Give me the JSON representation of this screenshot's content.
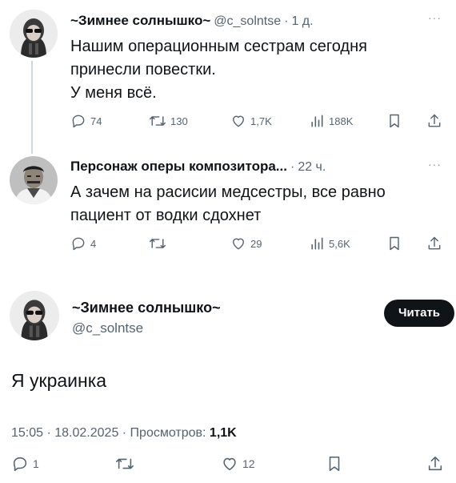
{
  "tweets": [
    {
      "author": "~Зимнее солнышко~",
      "handle": "@c_solntse",
      "time": "1 д.",
      "lines": [
        "Нашим операционным сестрам сегодня",
        "принесли повестки.",
        "У меня всё."
      ],
      "replies": "74",
      "retweets": "130",
      "likes": "1,7K",
      "views": "188K"
    },
    {
      "author": "Персонаж оперы композитора...",
      "time": "22 ч.",
      "lines": [
        "А зачем на расисии медсестры, все равно",
        "пациент от водки сдохнет"
      ],
      "replies": "4",
      "retweets": "",
      "likes": "29",
      "views": "5,6K"
    }
  ],
  "main": {
    "author": "~Зимнее солнышко~",
    "handle": "@c_solntse",
    "follow_label": "Читать",
    "text": "Я украинка",
    "timestamp": "15:05 · 18.02.2025 · Просмотров:",
    "views": "1,1K",
    "replies": "1",
    "retweets": "",
    "likes": "12"
  },
  "separator": "·",
  "more_glyph": "···",
  "colors": {
    "text": "#0f1419",
    "secondary": "#536471",
    "line": "#cfd9de",
    "button": "#0f1419"
  },
  "icons": [
    "reply-icon",
    "retweet-icon",
    "like-icon",
    "views-icon",
    "bookmark-icon",
    "share-icon",
    "more-icon"
  ]
}
